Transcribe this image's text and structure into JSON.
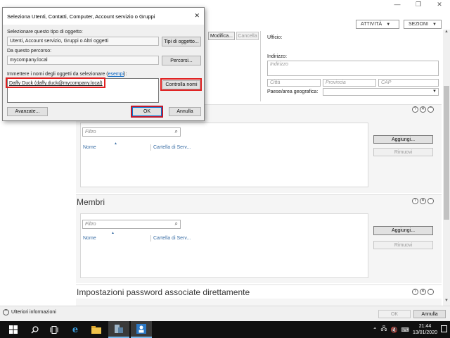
{
  "window": {
    "minimize": "—",
    "restore": "❐",
    "close": "✕"
  },
  "header": {
    "tasks_label": "ATTIVITÀ",
    "sections_label": "SEZIONI"
  },
  "general": {
    "modify_label": "Modifica...",
    "cancel_label": "Cancella",
    "office_label": "Ufficio:",
    "address_label": "Indirizzo:",
    "address_placeholder": "Indirizzo",
    "city_placeholder": "Città",
    "province_placeholder": "Provincia",
    "zip_placeholder": "CAP",
    "country_label": "Paese/area geografica:"
  },
  "section1": {
    "filter_placeholder": "Filtro",
    "col_name": "Nome",
    "col_folder": "Cartella di Serv...",
    "add_label": "Aggiungi...",
    "remove_label": "Rimuovi"
  },
  "members": {
    "title": "Membri",
    "filter_placeholder": "Filtro",
    "col_name": "Nome",
    "col_folder": "Cartella di Serv...",
    "add_label": "Aggiungi...",
    "remove_label": "Rimuovi"
  },
  "password_section": {
    "title": "Impostazioni password associate direttamente"
  },
  "bottom": {
    "more_info": "Ulteriori informazioni",
    "ok_label": "OK",
    "cancel_label": "Annulla"
  },
  "dialog": {
    "title": "Seleziona Utenti, Contatti, Computer, Account servizio o Gruppi",
    "object_type_label": "Selezionare questo tipo di oggetto:",
    "object_type_value": "Utenti, Account servizio, Gruppi o Altri oggetti",
    "object_type_button": "Tipi di oggetto...",
    "location_label": "Da questo percorso:",
    "location_value": "mycompany.local",
    "location_button": "Percorsi...",
    "names_label_prefix": "Immettere i nomi degli oggetti da selezionare (",
    "names_label_link": "esempi",
    "names_label_suffix": "):",
    "names_value": "Daffy Duck (daffy.duck@mycompany.local)",
    "check_names_button": "Controlla nomi",
    "advanced_button": "Avanzate...",
    "ok_button": "OK",
    "cancel_button": "Annulla"
  },
  "taskbar": {
    "clock_time": "21:44",
    "clock_date": "13/01/2020",
    "icons": [
      "windows-start-icon",
      "search-icon",
      "task-view-icon",
      "edge-icon",
      "file-explorer-icon",
      "server-manager-icon",
      "ad-admin-center-icon"
    ]
  }
}
